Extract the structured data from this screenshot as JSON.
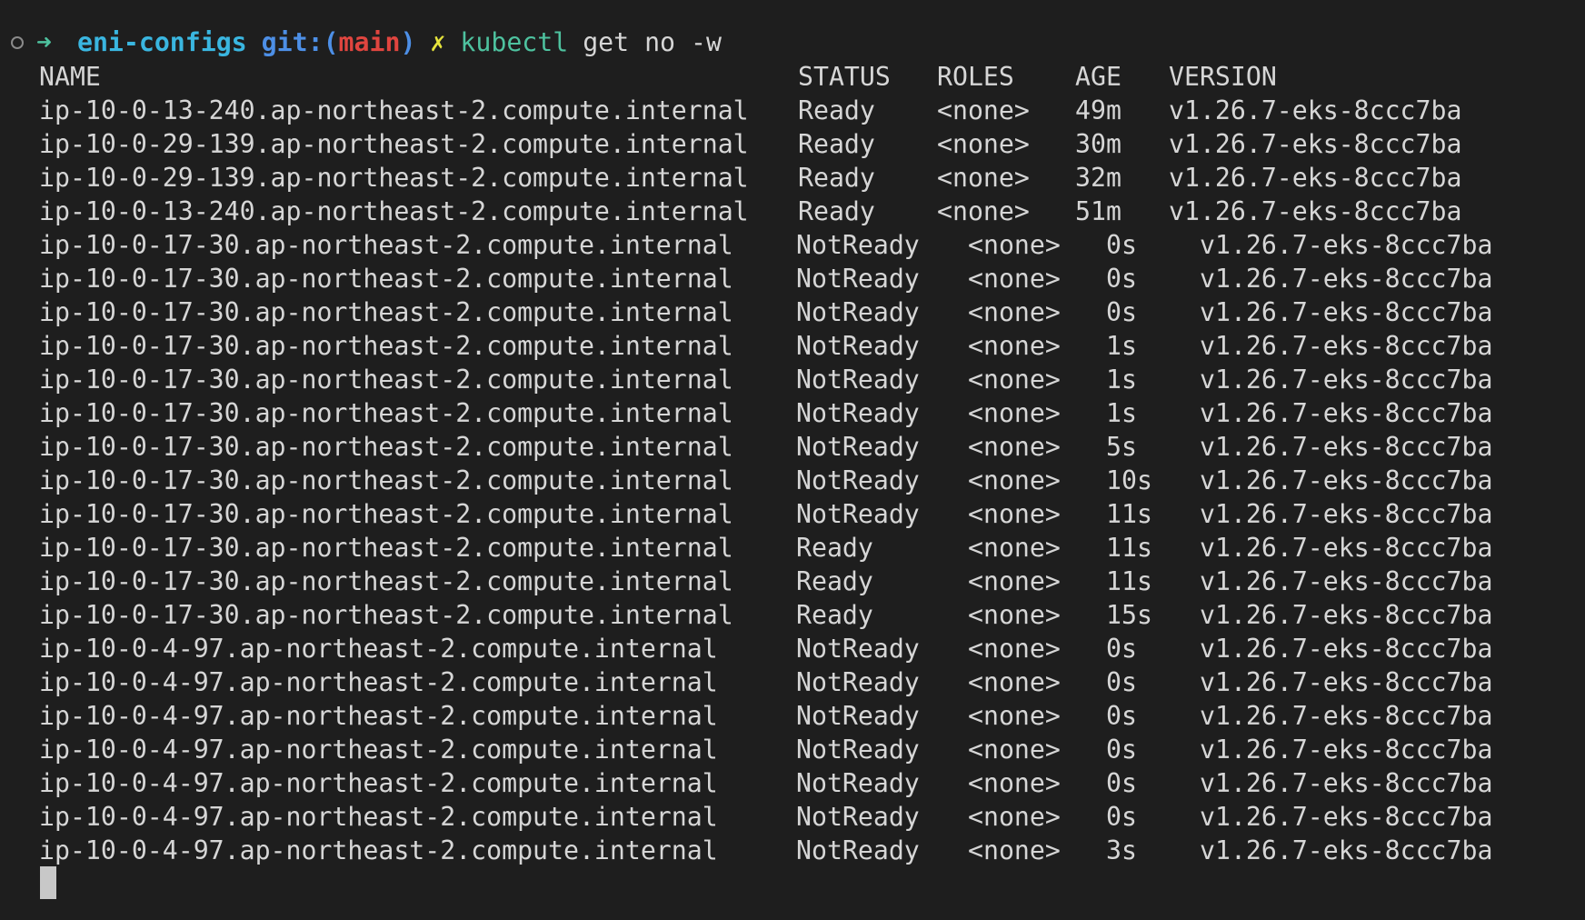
{
  "prompt": {
    "arrow": "➜",
    "directory": "eni-configs",
    "git_label": "git:",
    "paren_open": "(",
    "branch": "main",
    "paren_close": ")",
    "dirty_marker": "✗",
    "command": "kubectl",
    "arguments": "get no -w"
  },
  "table": {
    "headers": {
      "name": "NAME",
      "status": "STATUS",
      "roles": "ROLES",
      "age": "AGE",
      "version": "VERSION"
    },
    "rows": [
      {
        "name": "ip-10-0-13-240.ap-northeast-2.compute.internal",
        "status": "Ready",
        "roles": "<none>",
        "age": "49m",
        "version": "v1.26.7-eks-8ccc7ba"
      },
      {
        "name": "ip-10-0-29-139.ap-northeast-2.compute.internal",
        "status": "Ready",
        "roles": "<none>",
        "age": "30m",
        "version": "v1.26.7-eks-8ccc7ba"
      },
      {
        "name": "ip-10-0-29-139.ap-northeast-2.compute.internal",
        "status": "Ready",
        "roles": "<none>",
        "age": "32m",
        "version": "v1.26.7-eks-8ccc7ba"
      },
      {
        "name": "ip-10-0-13-240.ap-northeast-2.compute.internal",
        "status": "Ready",
        "roles": "<none>",
        "age": "51m",
        "version": "v1.26.7-eks-8ccc7ba"
      },
      {
        "name": "ip-10-0-17-30.ap-northeast-2.compute.internal",
        "status": "NotReady",
        "roles": "<none>",
        "age": "0s",
        "version": "v1.26.7-eks-8ccc7ba"
      },
      {
        "name": "ip-10-0-17-30.ap-northeast-2.compute.internal",
        "status": "NotReady",
        "roles": "<none>",
        "age": "0s",
        "version": "v1.26.7-eks-8ccc7ba"
      },
      {
        "name": "ip-10-0-17-30.ap-northeast-2.compute.internal",
        "status": "NotReady",
        "roles": "<none>",
        "age": "0s",
        "version": "v1.26.7-eks-8ccc7ba"
      },
      {
        "name": "ip-10-0-17-30.ap-northeast-2.compute.internal",
        "status": "NotReady",
        "roles": "<none>",
        "age": "1s",
        "version": "v1.26.7-eks-8ccc7ba"
      },
      {
        "name": "ip-10-0-17-30.ap-northeast-2.compute.internal",
        "status": "NotReady",
        "roles": "<none>",
        "age": "1s",
        "version": "v1.26.7-eks-8ccc7ba"
      },
      {
        "name": "ip-10-0-17-30.ap-northeast-2.compute.internal",
        "status": "NotReady",
        "roles": "<none>",
        "age": "1s",
        "version": "v1.26.7-eks-8ccc7ba"
      },
      {
        "name": "ip-10-0-17-30.ap-northeast-2.compute.internal",
        "status": "NotReady",
        "roles": "<none>",
        "age": "5s",
        "version": "v1.26.7-eks-8ccc7ba"
      },
      {
        "name": "ip-10-0-17-30.ap-northeast-2.compute.internal",
        "status": "NotReady",
        "roles": "<none>",
        "age": "10s",
        "version": "v1.26.7-eks-8ccc7ba"
      },
      {
        "name": "ip-10-0-17-30.ap-northeast-2.compute.internal",
        "status": "NotReady",
        "roles": "<none>",
        "age": "11s",
        "version": "v1.26.7-eks-8ccc7ba"
      },
      {
        "name": "ip-10-0-17-30.ap-northeast-2.compute.internal",
        "status": "Ready",
        "roles": "<none>",
        "age": "11s",
        "version": "v1.26.7-eks-8ccc7ba"
      },
      {
        "name": "ip-10-0-17-30.ap-northeast-2.compute.internal",
        "status": "Ready",
        "roles": "<none>",
        "age": "11s",
        "version": "v1.26.7-eks-8ccc7ba"
      },
      {
        "name": "ip-10-0-17-30.ap-northeast-2.compute.internal",
        "status": "Ready",
        "roles": "<none>",
        "age": "15s",
        "version": "v1.26.7-eks-8ccc7ba"
      },
      {
        "name": "ip-10-0-4-97.ap-northeast-2.compute.internal",
        "status": "NotReady",
        "roles": "<none>",
        "age": "0s",
        "version": "v1.26.7-eks-8ccc7ba"
      },
      {
        "name": "ip-10-0-4-97.ap-northeast-2.compute.internal",
        "status": "NotReady",
        "roles": "<none>",
        "age": "0s",
        "version": "v1.26.7-eks-8ccc7ba"
      },
      {
        "name": "ip-10-0-4-97.ap-northeast-2.compute.internal",
        "status": "NotReady",
        "roles": "<none>",
        "age": "0s",
        "version": "v1.26.7-eks-8ccc7ba"
      },
      {
        "name": "ip-10-0-4-97.ap-northeast-2.compute.internal",
        "status": "NotReady",
        "roles": "<none>",
        "age": "0s",
        "version": "v1.26.7-eks-8ccc7ba"
      },
      {
        "name": "ip-10-0-4-97.ap-northeast-2.compute.internal",
        "status": "NotReady",
        "roles": "<none>",
        "age": "0s",
        "version": "v1.26.7-eks-8ccc7ba"
      },
      {
        "name": "ip-10-0-4-97.ap-northeast-2.compute.internal",
        "status": "NotReady",
        "roles": "<none>",
        "age": "0s",
        "version": "v1.26.7-eks-8ccc7ba"
      },
      {
        "name": "ip-10-0-4-97.ap-northeast-2.compute.internal",
        "status": "NotReady",
        "roles": "<none>",
        "age": "3s",
        "version": "v1.26.7-eks-8ccc7ba"
      }
    ]
  },
  "colors": {
    "background": "#1e1e1e",
    "text": "#d6d6d6",
    "arrow": "#4ec29f",
    "directory": "#3ab6e0",
    "git_label": "#4d8fe6",
    "branch": "#e0453f",
    "dirty_marker": "#e6e43c",
    "command": "#4ec29f"
  }
}
